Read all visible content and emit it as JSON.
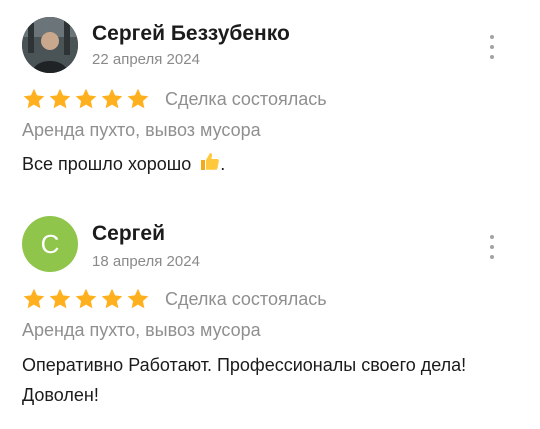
{
  "reviews": [
    {
      "author": "Сергей Беззубенко",
      "date": "22 апреля 2024",
      "avatar": "photo",
      "rating": 5,
      "deal_status": "Сделка состоялась",
      "service": "Аренда пухто, вывоз мусора",
      "text": "Все прошло хорошо",
      "emoji": "thumbs-up-icon",
      "text_end": "."
    },
    {
      "author": "Сергей",
      "date": "18 апреля 2024",
      "avatar": "С",
      "avatar_color": "#8fc54a",
      "rating": 5,
      "deal_status": "Сделка состоялась",
      "service": "Аренда пухто, вывоз мусора",
      "text": "Оперативно Работают. Профессионалы своего дела! Доволен!"
    }
  ],
  "colors": {
    "star": "#ffb01f",
    "muted_text": "#8f8f8f",
    "primary_text": "#1b1b1b"
  }
}
